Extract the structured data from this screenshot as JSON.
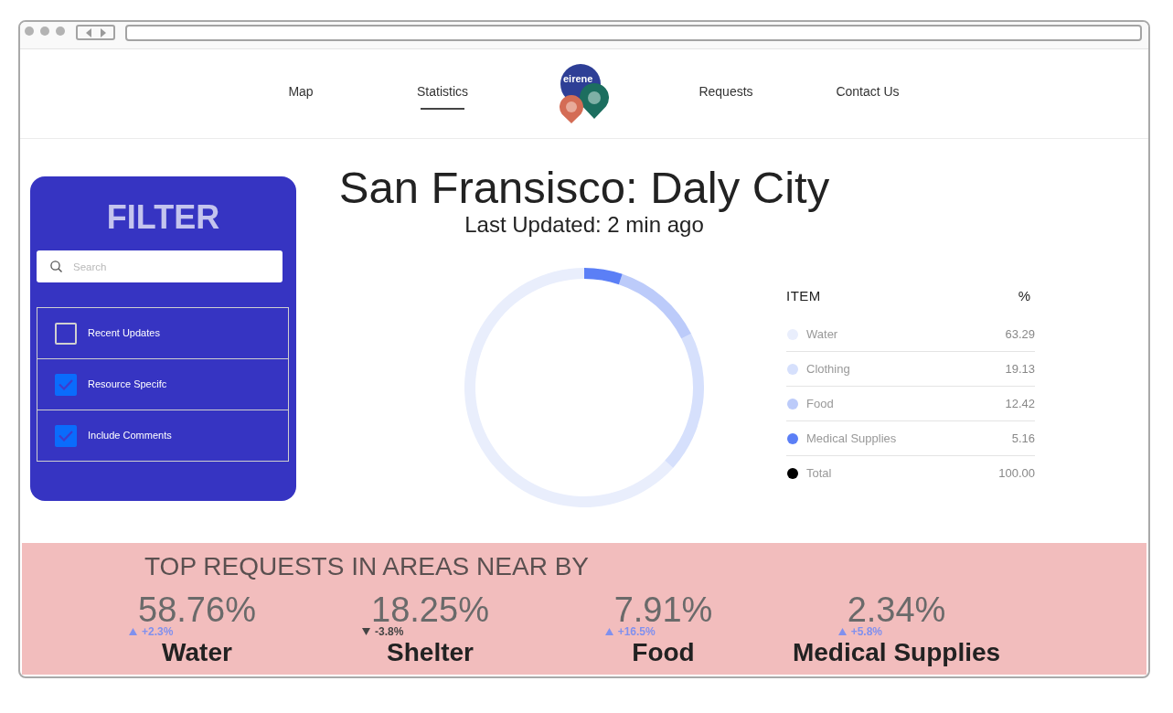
{
  "nav": {
    "left": [
      {
        "label": "Map",
        "selected": false
      },
      {
        "label": "Statistics",
        "selected": true
      }
    ],
    "logo": {
      "text": "eirene"
    },
    "right": [
      {
        "label": "Requests",
        "selected": false
      },
      {
        "label": "Contact Us",
        "selected": false
      }
    ]
  },
  "filter": {
    "title": "FILTER",
    "search": {
      "placeholder": "Search"
    },
    "items": [
      {
        "label": "Recent Updates",
        "checked": false
      },
      {
        "label": "Resource Specifc",
        "checked": true
      },
      {
        "label": "Include Comments",
        "checked": true
      }
    ]
  },
  "location": {
    "title": "San Fransisco: Daly City",
    "updated": "Last Updated: 2 min ago"
  },
  "breakdown": {
    "chart_data": {
      "type": "donut",
      "values": [
        63.29,
        19.13,
        12.42,
        5.16
      ],
      "colors": [
        "#e9eefc",
        "#d6e0fc",
        "#bccbfa",
        "#5b7ff6"
      ]
    },
    "table": {
      "columns": [
        "ITEM",
        "%"
      ],
      "rows": [
        {
          "label": "Water",
          "value": "63.29",
          "color": "#e9eefc"
        },
        {
          "label": "Clothing",
          "value": "19.13",
          "color": "#d6e0fc"
        },
        {
          "label": "Food",
          "value": "12.42",
          "color": "#bccbfa"
        },
        {
          "label": "Medical Supplies",
          "value": "5.16",
          "color": "#5b7ff6"
        },
        {
          "label": "Total",
          "value": "100.00",
          "color": "#000000"
        }
      ]
    }
  },
  "nearby": {
    "title": "TOP REQUESTS IN AREAS NEAR BY",
    "items": [
      {
        "percent": "58.76%",
        "change": "+2.3%",
        "rising": true,
        "name": "Water"
      },
      {
        "percent": "18.25%",
        "change": "-3.8%",
        "rising": false,
        "name": "Shelter"
      },
      {
        "percent": "7.91%",
        "change": "+16.5%",
        "rising": true,
        "name": "Food"
      },
      {
        "percent": "2.34%",
        "change": "+5.8%",
        "rising": true,
        "name": "Medical Supplies"
      }
    ]
  }
}
